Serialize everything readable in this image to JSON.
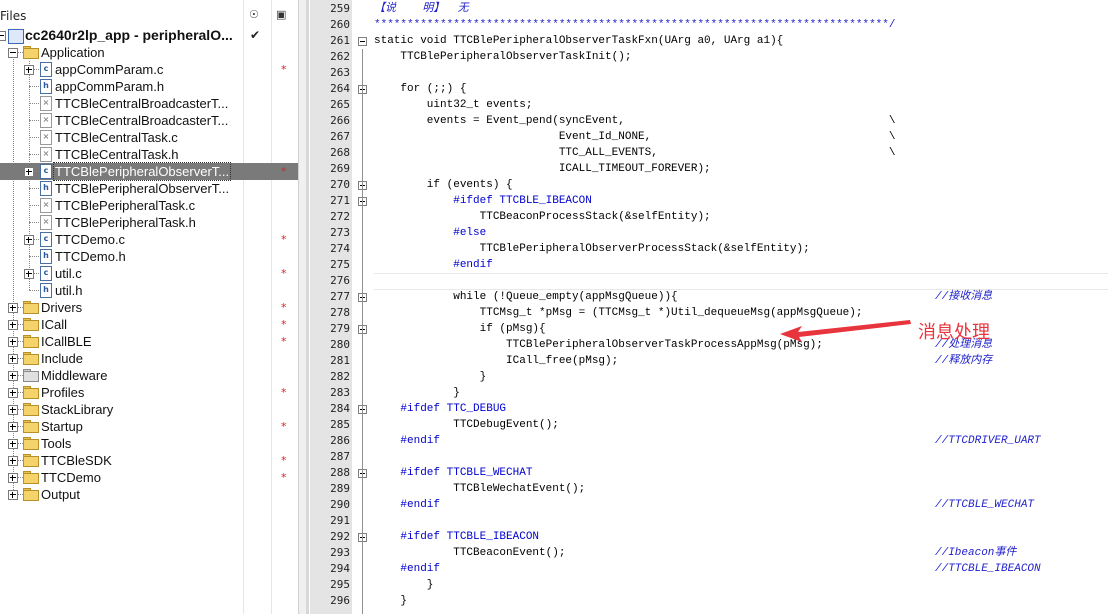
{
  "tree": {
    "header_title": "Files",
    "project": "cc2640r2lp_app - peripheralO...",
    "project_check": "✔",
    "items": [
      {
        "label": "Application",
        "star": ""
      },
      {
        "label": "appCommParam.c",
        "star": "*"
      },
      {
        "label": "appCommParam.h",
        "star": ""
      },
      {
        "label": "TTCBleCentralBroadcasterT...",
        "star": ""
      },
      {
        "label": "TTCBleCentralBroadcasterT...",
        "star": ""
      },
      {
        "label": "TTCBleCentralTask.c",
        "star": ""
      },
      {
        "label": "TTCBleCentralTask.h",
        "star": ""
      },
      {
        "label": "TTCBlePeripheralObserverT...",
        "star": "*"
      },
      {
        "label": "TTCBlePeripheralObserverT...",
        "star": ""
      },
      {
        "label": "TTCBlePeripheralTask.c",
        "star": ""
      },
      {
        "label": "TTCBlePeripheralTask.h",
        "star": ""
      },
      {
        "label": "TTCDemo.c",
        "star": "*"
      },
      {
        "label": "TTCDemo.h",
        "star": ""
      },
      {
        "label": "util.c",
        "star": "*"
      },
      {
        "label": "util.h",
        "star": ""
      },
      {
        "label": "Drivers",
        "star": "*"
      },
      {
        "label": "ICall",
        "star": "*"
      },
      {
        "label": "ICallBLE",
        "star": "*"
      },
      {
        "label": "Include",
        "star": ""
      },
      {
        "label": "Middleware",
        "star": ""
      },
      {
        "label": "Profiles",
        "star": "*"
      },
      {
        "label": "StackLibrary",
        "star": ""
      },
      {
        "label": "Startup",
        "star": "*"
      },
      {
        "label": "Tools",
        "star": ""
      },
      {
        "label": "TTCBleSDK",
        "star": "*"
      },
      {
        "label": "TTCDemo",
        "star": "*"
      },
      {
        "label": "Output",
        "star": ""
      }
    ]
  },
  "editor": {
    "lines": [
      {
        "n": "259",
        "t": "【说    明】  无"
      },
      {
        "n": "260",
        "t": "******************************************************************************/"
      },
      {
        "n": "261",
        "t": "static void TTCBlePeripheralObserverTaskFxn(UArg a0, UArg a1){"
      },
      {
        "n": "262",
        "t": "    TTCBlePeripheralObserverTaskInit();"
      },
      {
        "n": "263",
        "t": ""
      },
      {
        "n": "264",
        "t": "    for (;;) {"
      },
      {
        "n": "265",
        "t": "        uint32_t events;"
      },
      {
        "n": "266",
        "t": "        events = Event_pend(syncEvent,                                        \\"
      },
      {
        "n": "267",
        "t": "                            Event_Id_NONE,                                    \\"
      },
      {
        "n": "268",
        "t": "                            TTC_ALL_EVENTS,                                   \\"
      },
      {
        "n": "269",
        "t": "                            ICALL_TIMEOUT_FOREVER);"
      },
      {
        "n": "270",
        "t": "        if (events) {"
      },
      {
        "n": "271",
        "t": "            #ifdef TTCBLE_IBEACON"
      },
      {
        "n": "272",
        "t": "                TTCBeaconProcessStack(&selfEntity);"
      },
      {
        "n": "273",
        "t": "            #else"
      },
      {
        "n": "274",
        "t": "                TTCBlePeripheralObserverProcessStack(&selfEntity);"
      },
      {
        "n": "275",
        "t": "            #endif"
      },
      {
        "n": "276",
        "t": ""
      },
      {
        "n": "277",
        "t": "            while (!Queue_empty(appMsgQueue)){"
      },
      {
        "n": "278",
        "t": "                TTCMsg_t *pMsg = (TTCMsg_t *)Util_dequeueMsg(appMsgQueue);"
      },
      {
        "n": "279",
        "t": "                if (pMsg){"
      },
      {
        "n": "280",
        "t": "                    TTCBlePeripheralObserverTaskProcessAppMsg(pMsg);"
      },
      {
        "n": "281",
        "t": "                    ICall_free(pMsg);"
      },
      {
        "n": "282",
        "t": "                }"
      },
      {
        "n": "283",
        "t": "            }"
      },
      {
        "n": "284",
        "t": "    #ifdef TTC_DEBUG"
      },
      {
        "n": "285",
        "t": "            TTCDebugEvent();"
      },
      {
        "n": "286",
        "t": "    #endif"
      },
      {
        "n": "287",
        "t": ""
      },
      {
        "n": "288",
        "t": "    #ifdef TTCBLE_WECHAT"
      },
      {
        "n": "289",
        "t": "            TTCBleWechatEvent();"
      },
      {
        "n": "290",
        "t": "    #endif"
      },
      {
        "n": "291",
        "t": ""
      },
      {
        "n": "292",
        "t": "    #ifdef TTCBLE_IBEACON"
      },
      {
        "n": "293",
        "t": "            TTCBeaconEvent();"
      },
      {
        "n": "294",
        "t": "    #endif"
      },
      {
        "n": "295",
        "t": "        }"
      },
      {
        "n": "296",
        "t": "    }"
      }
    ],
    "right_comments": [
      {
        "n": "277",
        "t": "//接收消息"
      },
      {
        "n": "280",
        "t": "//处理消息"
      },
      {
        "n": "281",
        "t": "//释放内存"
      },
      {
        "n": "286",
        "t": "//TTCDRIVER_UART"
      },
      {
        "n": "290",
        "t": "//TTCBLE_WECHAT"
      },
      {
        "n": "293",
        "t": "//Ibeacon事件"
      },
      {
        "n": "294",
        "t": "//TTCBLE_IBEACON"
      }
    ],
    "annotation": "消息处理",
    "annotation_color": "#e8343c"
  }
}
